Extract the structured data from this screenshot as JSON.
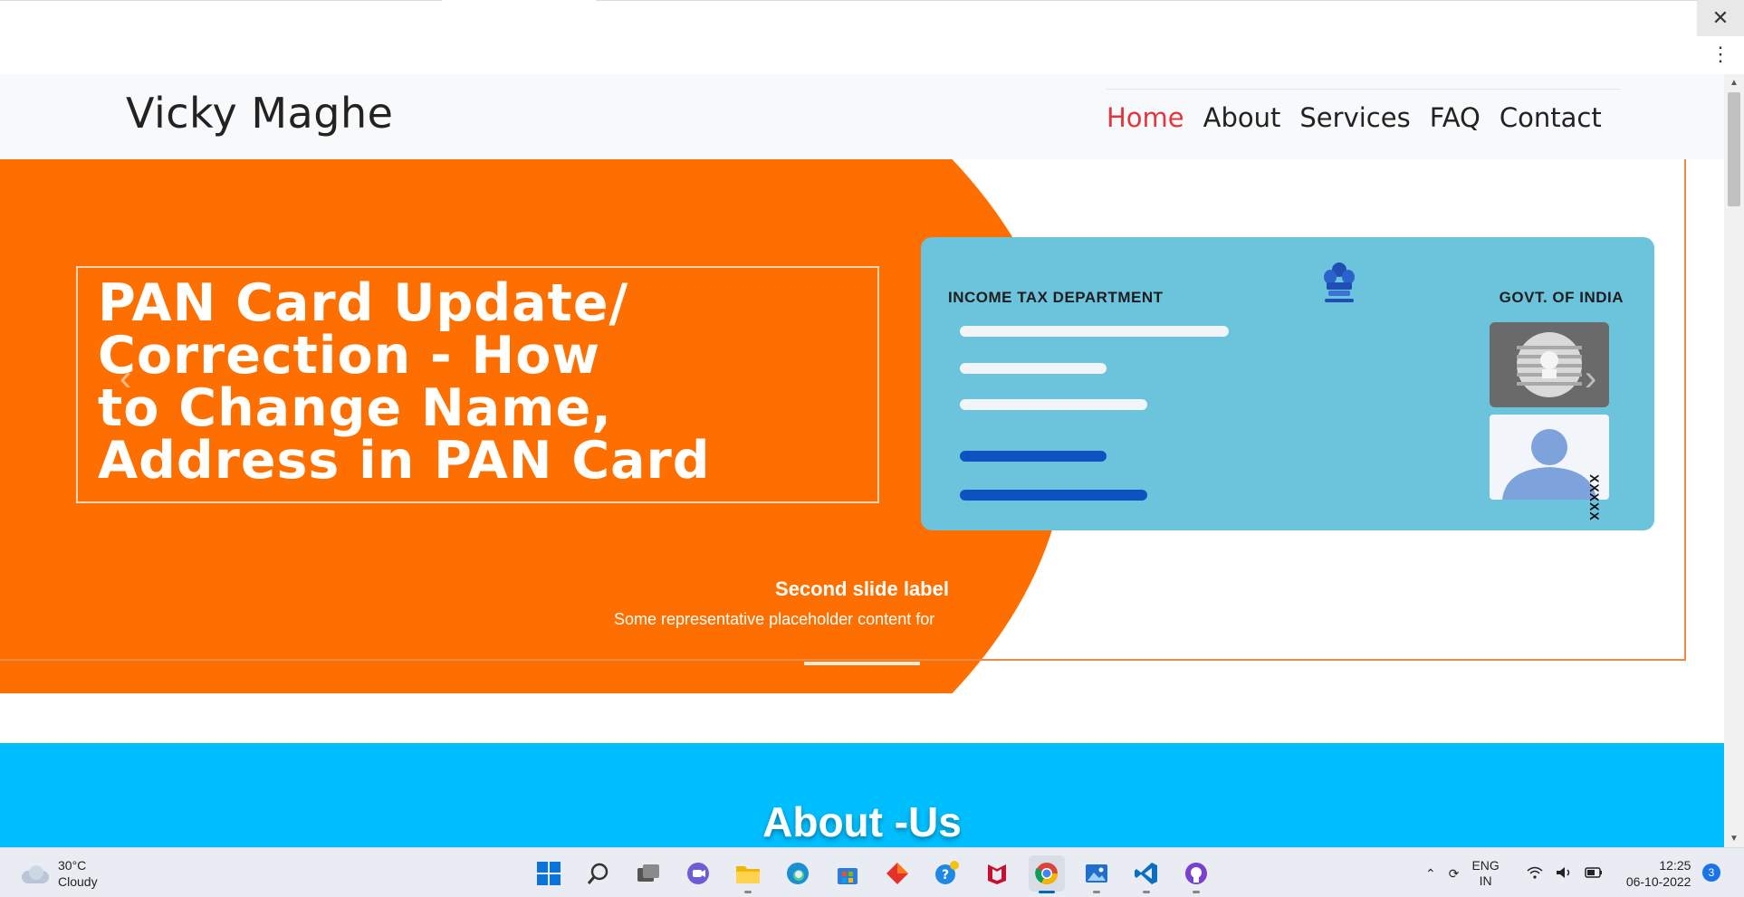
{
  "browser": {
    "close_glyph": "✕",
    "menu_glyph": "⋮"
  },
  "site": {
    "brand": "Vicky Maghe",
    "nav": [
      {
        "label": "Home",
        "active": true
      },
      {
        "label": "About",
        "active": false
      },
      {
        "label": "Services",
        "active": false
      },
      {
        "label": "FAQ",
        "active": false
      },
      {
        "label": "Contact",
        "active": false
      }
    ]
  },
  "carousel": {
    "headline": [
      "PAN Card Update/",
      "Correction - How",
      "to Change Name,",
      "Address in PAN Card"
    ],
    "card": {
      "department": "INCOME TAX DEPARTMENT",
      "government": "GOVT. OF INDIA",
      "number_placeholder": "XXXXX"
    },
    "caption_title": "Second slide label",
    "caption_text": "Some representative placeholder content for the second slide.",
    "prev_glyph": "‹",
    "next_glyph": "›",
    "active_slide": 2,
    "slide_count": 3
  },
  "about": {
    "title": "About -Us"
  },
  "colors": {
    "accent_orange": "#ff6f00",
    "about_blue": "#00bfff",
    "nav_active": "#e5343f",
    "card_blue": "#6cc3dc"
  },
  "taskbar": {
    "weather": {
      "temp": "30°C",
      "condition": "Cloudy"
    },
    "apps": [
      "start-icon",
      "search-icon",
      "task-view-icon",
      "meet-icon",
      "file-explorer-icon",
      "edge-icon",
      "store-icon",
      "app-diamond-icon",
      "help-icon",
      "mcafee-icon",
      "chrome-icon",
      "photos-icon",
      "vscode-icon",
      "github-desktop-icon"
    ],
    "language": {
      "line1": "ENG",
      "line2": "IN"
    },
    "time": "12:25",
    "date": "06-10-2022",
    "notification_count": "3"
  }
}
